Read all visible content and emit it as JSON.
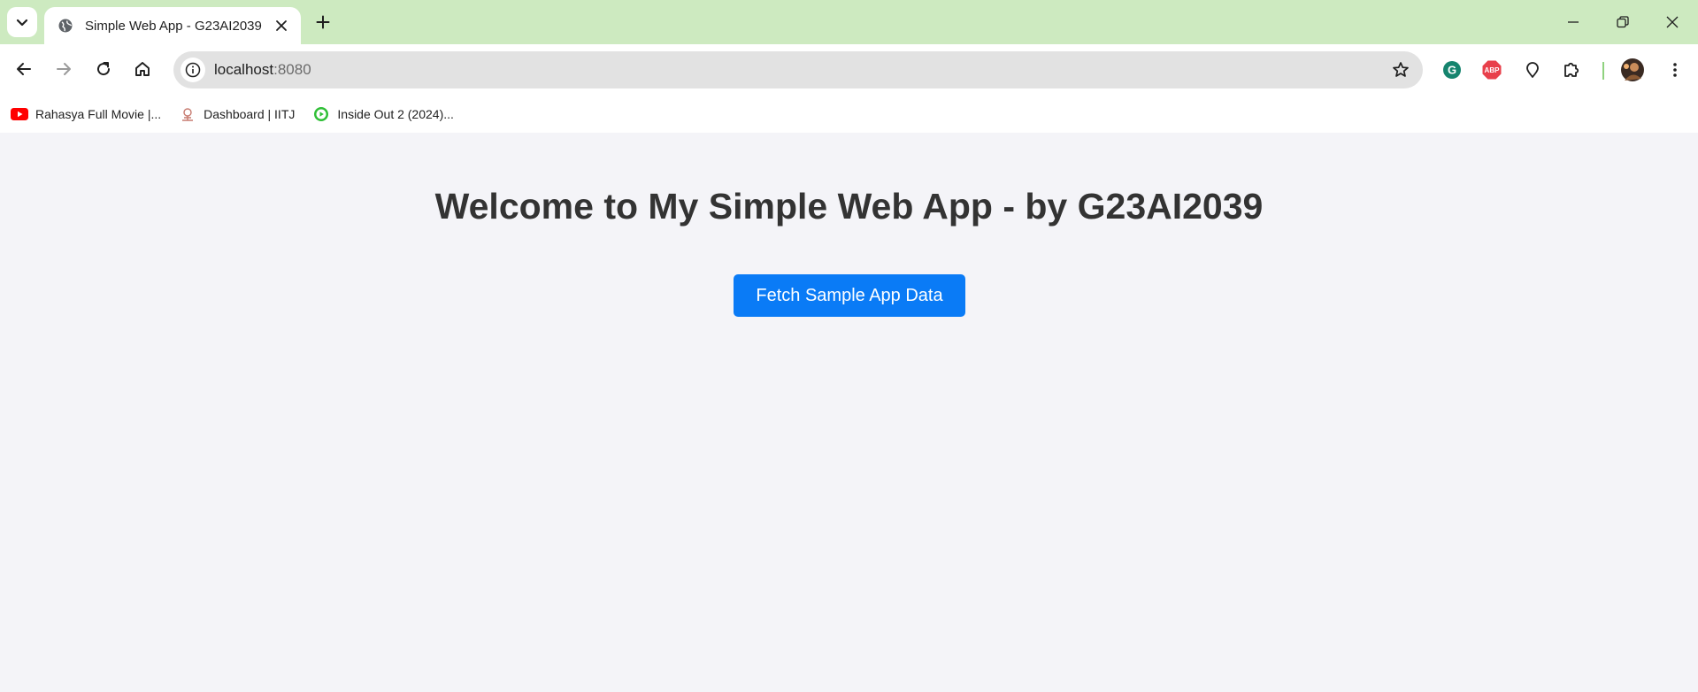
{
  "tab": {
    "title": "Simple Web App - G23AI2039"
  },
  "address_bar": {
    "host": "localhost",
    "port": ":8080"
  },
  "bookmarks": [
    {
      "label": "Rahasya Full Movie |...",
      "icon": "youtube-icon"
    },
    {
      "label": "Dashboard | IITJ",
      "icon": "iitj-logo-icon"
    },
    {
      "label": "Inside Out 2 (2024)...",
      "icon": "play-icon"
    }
  ],
  "extensions": [
    {
      "name": "grammarly-icon",
      "label": "G"
    },
    {
      "name": "adblock-plus-icon",
      "label": "ABP"
    }
  ],
  "main": {
    "heading": "Welcome to My Simple Web App - by G23AI2039",
    "fetch_button_label": "Fetch Sample App Data"
  },
  "colors": {
    "tabstrip_bg": "#cdeac0",
    "page_bg": "#f4f4f8",
    "button_bg": "#0a7bf6",
    "heading_color": "#333333"
  }
}
